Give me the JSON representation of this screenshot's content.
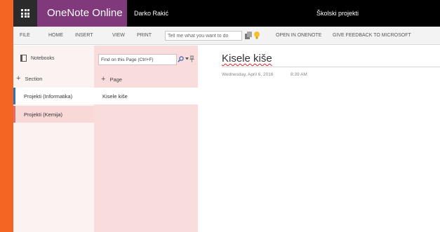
{
  "titlebar": {
    "app_name": "OneNote Online",
    "user_name": "Darko Rakić",
    "notebook_name": "Školski projekti"
  },
  "ribbon": {
    "tabs": [
      "FILE",
      "HOME",
      "INSERT",
      "VIEW",
      "PRINT"
    ],
    "tell_me_placeholder": "Tell me what you want to do",
    "open_in_onenote": "OPEN IN ONENOTE",
    "give_feedback": "GIVE FEEDBACK TO MICROSOFT"
  },
  "notebooks_pane": {
    "header": "Notebooks",
    "add_section": "Section",
    "sections": [
      {
        "label": "Projekti (Informatika)",
        "color": "#2e74b5",
        "selected": true
      },
      {
        "label": "Projekti (Kemija)",
        "color": "#e06d6d",
        "selected": false
      }
    ]
  },
  "pages_pane": {
    "search_placeholder": "Find on this Page (Ctrl+F)",
    "add_page": "Page",
    "pages": [
      {
        "label": "Kisele kiše",
        "selected": true
      }
    ]
  },
  "canvas": {
    "title": "Kisele kiše",
    "date": "Wednesday, April 6, 2016",
    "time": "8:39 AM"
  },
  "colors": {
    "background_orange": "#f26522",
    "titlebar_black": "#000000",
    "brand_purple": "#80397b",
    "notebooks_pane_bg": "#fbf3f2",
    "pages_pane_bg": "#f9dcdc"
  },
  "icons": [
    "app-launcher-icon",
    "notebook-icon",
    "add-icon",
    "search-icon",
    "dropdown-caret-icon",
    "pin-icon",
    "ribbon-app-icon",
    "lightbulb-icon"
  ]
}
